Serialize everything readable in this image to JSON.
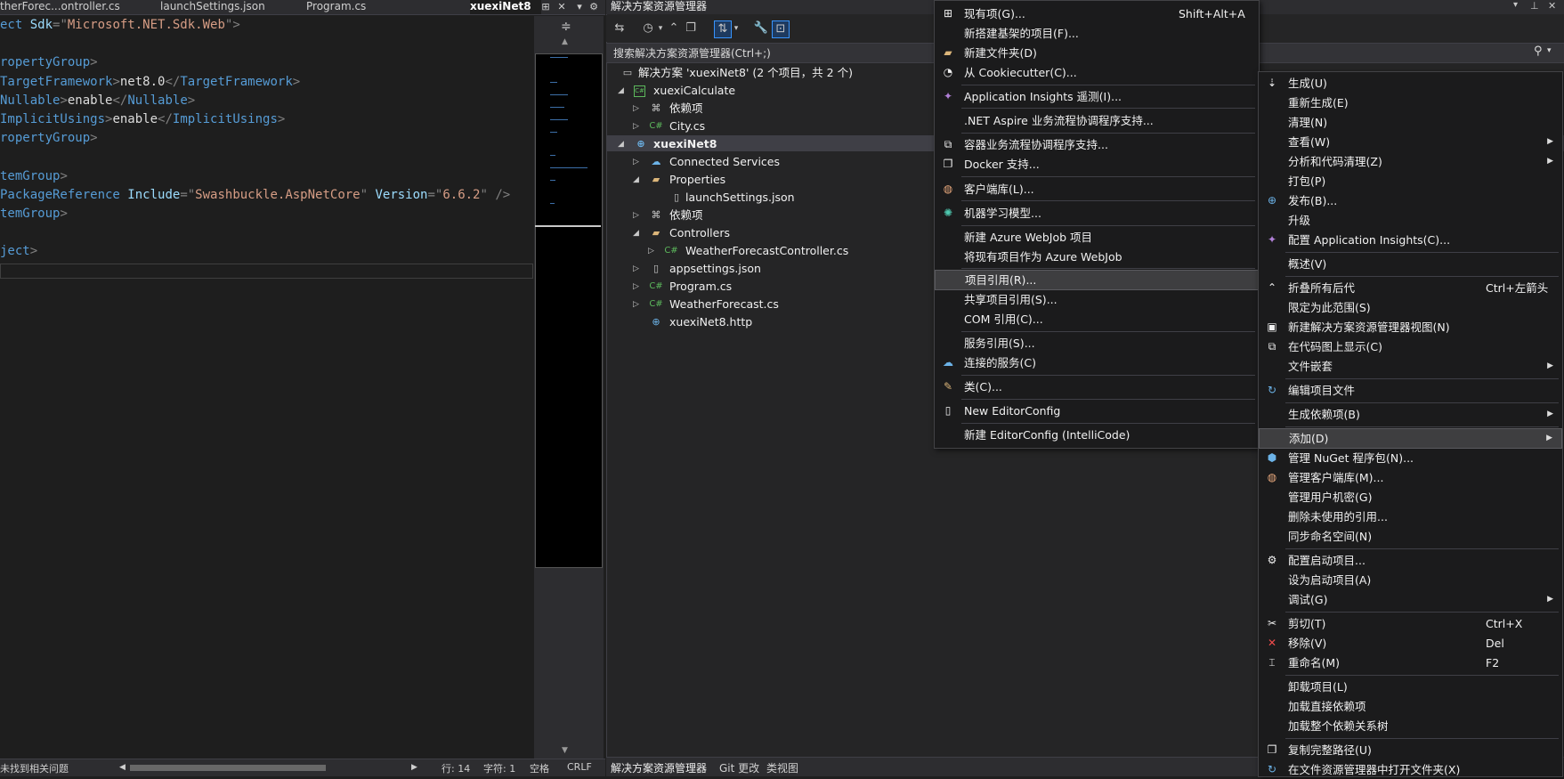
{
  "editor": {
    "tabs": [
      "therForec...ontroller.cs",
      "launchSettings.json",
      "Program.cs",
      "xuexiNet8"
    ],
    "lines": [
      [
        "ect ",
        "Sdk",
        "=\"",
        "Microsoft.NET.Sdk.Web",
        "\">"
      ],
      [
        "ropertyGroup",
        ">"
      ],
      [
        "TargetFramework",
        ">",
        "net8.0",
        "</",
        "TargetFramework",
        ">"
      ],
      [
        "Nullable",
        ">",
        "enable",
        "</",
        "Nullable",
        ">"
      ],
      [
        "ImplicitUsings",
        ">",
        "enable",
        "</",
        "ImplicitUsings",
        ">"
      ],
      [
        "ropertyGroup",
        ">"
      ],
      [
        "temGroup",
        ">"
      ],
      [
        "PackageReference ",
        "Include",
        "=\"",
        "Swashbuckle.AspNetCore",
        "\" ",
        "Version",
        "=\"",
        "6.6.2",
        "\" />"
      ],
      [
        "temGroup",
        ">"
      ],
      [
        "ject",
        ">"
      ]
    ],
    "status": {
      "issues": "未找到相关问题",
      "line": "行: 14",
      "char": "字符: 1",
      "space": "空格",
      "eol": "CRLF"
    }
  },
  "solution_explorer": {
    "title": "解决方案资源管理器",
    "search_placeholder": "搜索解决方案资源管理器(Ctrl+;)",
    "tree": [
      {
        "label": "解决方案 'xuexiNet8' (2 个项目，共 2 个)",
        "icon": "solution-icon"
      },
      {
        "label": "xuexiCalculate",
        "icon": "csproj-icon"
      },
      {
        "label": "依赖项",
        "icon": "dependencies-icon"
      },
      {
        "label": "City.cs",
        "icon": "csharp-file-icon"
      },
      {
        "label": "xuexiNet8",
        "icon": "web-project-icon"
      },
      {
        "label": "Connected Services",
        "icon": "connected-services-icon"
      },
      {
        "label": "Properties",
        "icon": "folder-icon"
      },
      {
        "label": "launchSettings.json",
        "icon": "json-file-icon"
      },
      {
        "label": "依赖项",
        "icon": "dependencies-icon"
      },
      {
        "label": "Controllers",
        "icon": "folder-icon"
      },
      {
        "label": "WeatherForecastController.cs",
        "icon": "csharp-file-icon"
      },
      {
        "label": "appsettings.json",
        "icon": "json-file-icon"
      },
      {
        "label": "Program.cs",
        "icon": "csharp-file-icon"
      },
      {
        "label": "WeatherForecast.cs",
        "icon": "csharp-file-icon"
      },
      {
        "label": "xuexiNet8.http",
        "icon": "http-file-icon"
      }
    ],
    "bottom_tabs": [
      "解决方案资源管理器",
      "Git 更改",
      "类视图"
    ]
  },
  "add_submenu": [
    {
      "label": "现有项(G)...",
      "shortcut": "Shift+Alt+A",
      "icon": "existing-item-icon"
    },
    {
      "label": "新搭建基架的项目(F)...",
      "icon": ""
    },
    {
      "label": "新建文件夹(D)",
      "icon": "new-folder-icon"
    },
    {
      "label": "从 Cookiecutter(C)...",
      "icon": "cookiecutter-icon"
    },
    {
      "label": "Application Insights 遥测(I)...",
      "icon": "app-insights-icon"
    },
    {
      "label": ".NET Aspire 业务流程协调程序支持...",
      "icon": ""
    },
    {
      "label": "容器业务流程协调程序支持...",
      "icon": "container-icon"
    },
    {
      "label": "Docker 支持...",
      "icon": "docker-icon"
    },
    {
      "label": "客户端库(L)...",
      "icon": "client-library-icon"
    },
    {
      "label": "机器学习模型...",
      "icon": "ml-model-icon"
    },
    {
      "label": "新建 Azure WebJob 项目",
      "icon": ""
    },
    {
      "label": "将现有项目作为 Azure WebJob",
      "icon": ""
    },
    {
      "label": "项目引用(R)...",
      "icon": ""
    },
    {
      "label": "共享项目引用(S)...",
      "icon": ""
    },
    {
      "label": "COM 引用(C)...",
      "icon": ""
    },
    {
      "label": "服务引用(S)...",
      "icon": ""
    },
    {
      "label": "连接的服务(C)",
      "icon": "connected-service-icon"
    },
    {
      "label": "类(C)...",
      "icon": "class-icon"
    },
    {
      "label": "New EditorConfig",
      "icon": "editorconfig-icon"
    },
    {
      "label": "新建 EditorConfig (IntelliCode)",
      "icon": ""
    }
  ],
  "context_menu": [
    {
      "label": "生成(U)",
      "icon": "build-icon"
    },
    {
      "label": "重新生成(E)",
      "icon": ""
    },
    {
      "label": "清理(N)",
      "icon": ""
    },
    {
      "label": "查看(W)",
      "icon": ""
    },
    {
      "label": "分析和代码清理(Z)",
      "icon": ""
    },
    {
      "label": "打包(P)",
      "icon": ""
    },
    {
      "label": "发布(B)...",
      "icon": "publish-icon"
    },
    {
      "label": "升级",
      "icon": ""
    },
    {
      "label": "配置 Application Insights(C)...",
      "icon": "app-insights-icon"
    },
    {
      "label": "概述(V)",
      "icon": ""
    },
    {
      "label": "折叠所有后代",
      "shortcut": "Ctrl+左箭头",
      "icon": "collapse-icon"
    },
    {
      "label": "限定为此范围(S)",
      "icon": ""
    },
    {
      "label": "新建解决方案资源管理器视图(N)",
      "icon": "new-view-icon"
    },
    {
      "label": "在代码图上显示(C)",
      "icon": "code-map-icon"
    },
    {
      "label": "文件嵌套",
      "icon": ""
    },
    {
      "label": "编辑项目文件",
      "icon": "edit-project-icon"
    },
    {
      "label": "生成依赖项(B)",
      "icon": ""
    },
    {
      "label": "添加(D)",
      "icon": ""
    },
    {
      "label": "管理 NuGet 程序包(N)...",
      "icon": "nuget-icon"
    },
    {
      "label": "管理客户端库(M)...",
      "icon": "client-library-icon"
    },
    {
      "label": "管理用户机密(G)",
      "icon": ""
    },
    {
      "label": "删除未使用的引用...",
      "icon": ""
    },
    {
      "label": "同步命名空间(N)",
      "icon": ""
    },
    {
      "label": "配置启动项目...",
      "icon": "gear-icon"
    },
    {
      "label": "设为启动项目(A)",
      "icon": ""
    },
    {
      "label": "调试(G)",
      "icon": ""
    },
    {
      "label": "剪切(T)",
      "shortcut": "Ctrl+X",
      "icon": "scissors-icon"
    },
    {
      "label": "移除(V)",
      "shortcut": "Del",
      "icon": "remove-icon"
    },
    {
      "label": "重命名(M)",
      "shortcut": "F2",
      "icon": "rename-icon"
    },
    {
      "label": "卸载项目(L)",
      "icon": ""
    },
    {
      "label": "加载直接依赖项",
      "icon": ""
    },
    {
      "label": "加载整个依赖关系树",
      "icon": ""
    },
    {
      "label": "复制完整路径(U)",
      "icon": "copy-path-icon"
    },
    {
      "label": "在文件资源管理器中打开文件夹(X)",
      "icon": "open-folder-icon"
    }
  ]
}
